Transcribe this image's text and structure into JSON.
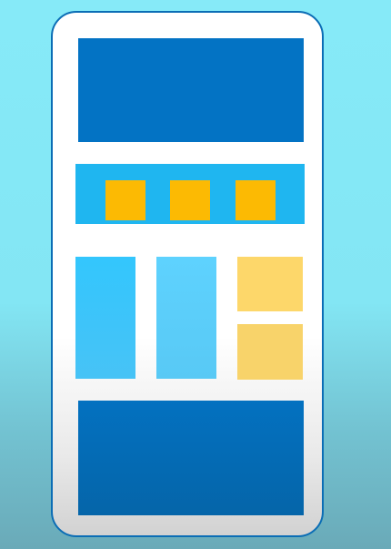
{
  "illustration": {
    "subject": "phone-layout-wireframe",
    "colors": {
      "background_top": "#86eaf8",
      "background_bottom": "#6aaab8",
      "phone_outline": "#0b6db5",
      "phone_body": "#ffffff",
      "dark_blue_block": "#0373c4",
      "sky_blue_block": "#1fb6f0",
      "light_blue_block": "#33c6fd",
      "pale_blue_block": "#5ed2fe",
      "gold_tile": "#fcba03",
      "light_gold_card": "#fdd76a"
    }
  }
}
